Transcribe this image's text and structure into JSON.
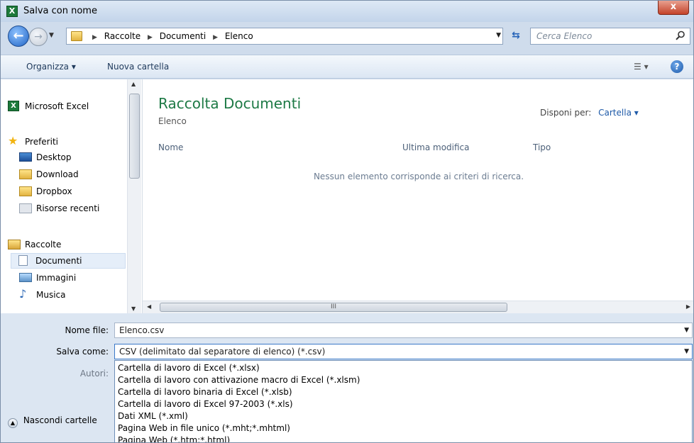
{
  "window": {
    "title": "Salva con nome",
    "close_label": "x"
  },
  "navbar": {
    "breadcrumbs": [
      "Raccolte",
      "Documenti",
      "Elenco"
    ],
    "search_placeholder": "Cerca Elenco"
  },
  "toolbar": {
    "organize_label": "Organizza ▾",
    "new_folder_label": "Nuova cartella"
  },
  "sidebar": {
    "app_item": "Microsoft Excel",
    "favorites_header": "Preferiti",
    "favorites": [
      "Desktop",
      "Download",
      "Dropbox",
      "Risorse recenti"
    ],
    "libraries_header": "Raccolte",
    "libraries": [
      "Documenti",
      "Immagini",
      "Musica"
    ]
  },
  "content": {
    "library_title": "Raccolta Documenti",
    "library_subtitle": "Elenco",
    "arrange_label": "Disponi per:",
    "arrange_value": "Cartella ▾",
    "columns": [
      "Nome",
      "Ultima modifica",
      "Tipo"
    ],
    "empty_message": "Nessun elemento corrisponde ai criteri di ricerca."
  },
  "form": {
    "filename_label": "Nome file:",
    "filename_value": "Elenco.csv",
    "save_as_label": "Salva come:",
    "save_as_value": "CSV (delimitato dal separatore di elenco) (*.csv)",
    "authors_label": "Autori:",
    "hide_folders_label": "Nascondi cartelle"
  },
  "save_as_options": [
    "Cartella di lavoro di Excel (*.xlsx)",
    "Cartella di lavoro con attivazione macro di Excel (*.xlsm)",
    "Cartella di lavoro binaria di Excel (*.xlsb)",
    "Cartella di lavoro di Excel 97-2003 (*.xls)",
    "Dati XML (*.xml)",
    "Pagina Web in file unico (*.mht;*.mhtml)",
    "Pagina Web (*.htm;*.html)"
  ]
}
